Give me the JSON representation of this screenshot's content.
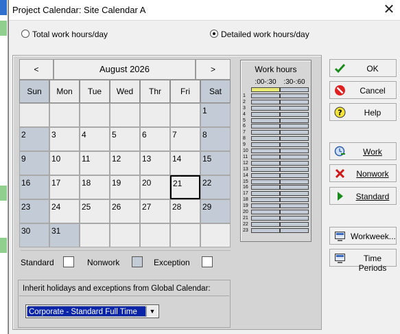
{
  "window": {
    "title": "Project Calendar: Site Calendar A",
    "close_label": "✕"
  },
  "options": {
    "total_label": "Total work hours/day",
    "detailed_label": "Detailed work hours/day",
    "selected": "detailed"
  },
  "calendar": {
    "month_label": "August 2026",
    "prev_label": "<",
    "next_label": ">",
    "weekdays": [
      "Sun",
      "Mon",
      "Tue",
      "Wed",
      "Thr",
      "Fri",
      "Sat"
    ],
    "weeks": [
      [
        "",
        "",
        "",
        "",
        "",
        "",
        "1"
      ],
      [
        "2",
        "3",
        "4",
        "5",
        "6",
        "7",
        "8"
      ],
      [
        "9",
        "10",
        "11",
        "12",
        "13",
        "14",
        "15"
      ],
      [
        "16",
        "17",
        "18",
        "19",
        "20",
        "21",
        "22"
      ],
      [
        "23",
        "24",
        "25",
        "26",
        "27",
        "28",
        "29"
      ],
      [
        "30",
        "31",
        "",
        "",
        "",
        "",
        ""
      ]
    ],
    "nonwork_days": [
      "1",
      "2",
      "8",
      "9",
      "15",
      "16",
      "22",
      "23",
      "29",
      "30",
      "31"
    ],
    "selected_day": "21"
  },
  "legend": {
    "standard": "Standard",
    "nonwork": "Nonwork",
    "exception": "Exception"
  },
  "inherit": {
    "label": "Inherit holidays and exceptions from Global Calendar:",
    "value": "Corporate - Standard Full Time"
  },
  "work_hours": {
    "title": "Work hours",
    "col1": ":00-:30",
    "col2": ":30-:60",
    "rows": [
      "",
      "1",
      "2",
      "3",
      "4",
      "5",
      "6",
      "7",
      "8",
      "9",
      "10",
      "11",
      "12",
      "13",
      "14",
      "15",
      "16",
      "17",
      "18",
      "19",
      "20",
      "21",
      "22",
      "23"
    ]
  },
  "buttons": {
    "ok": "OK",
    "cancel": "Cancel",
    "help": "Help",
    "work": "Work",
    "nonwork": "Nonwork",
    "standard": "Standard",
    "workweek": "Workweek...",
    "time_periods": "Time Periods"
  },
  "colors": {
    "nonwork": "#c3ccd6",
    "selection": "#0a24a8",
    "highlight_slot": "#e8e874"
  }
}
